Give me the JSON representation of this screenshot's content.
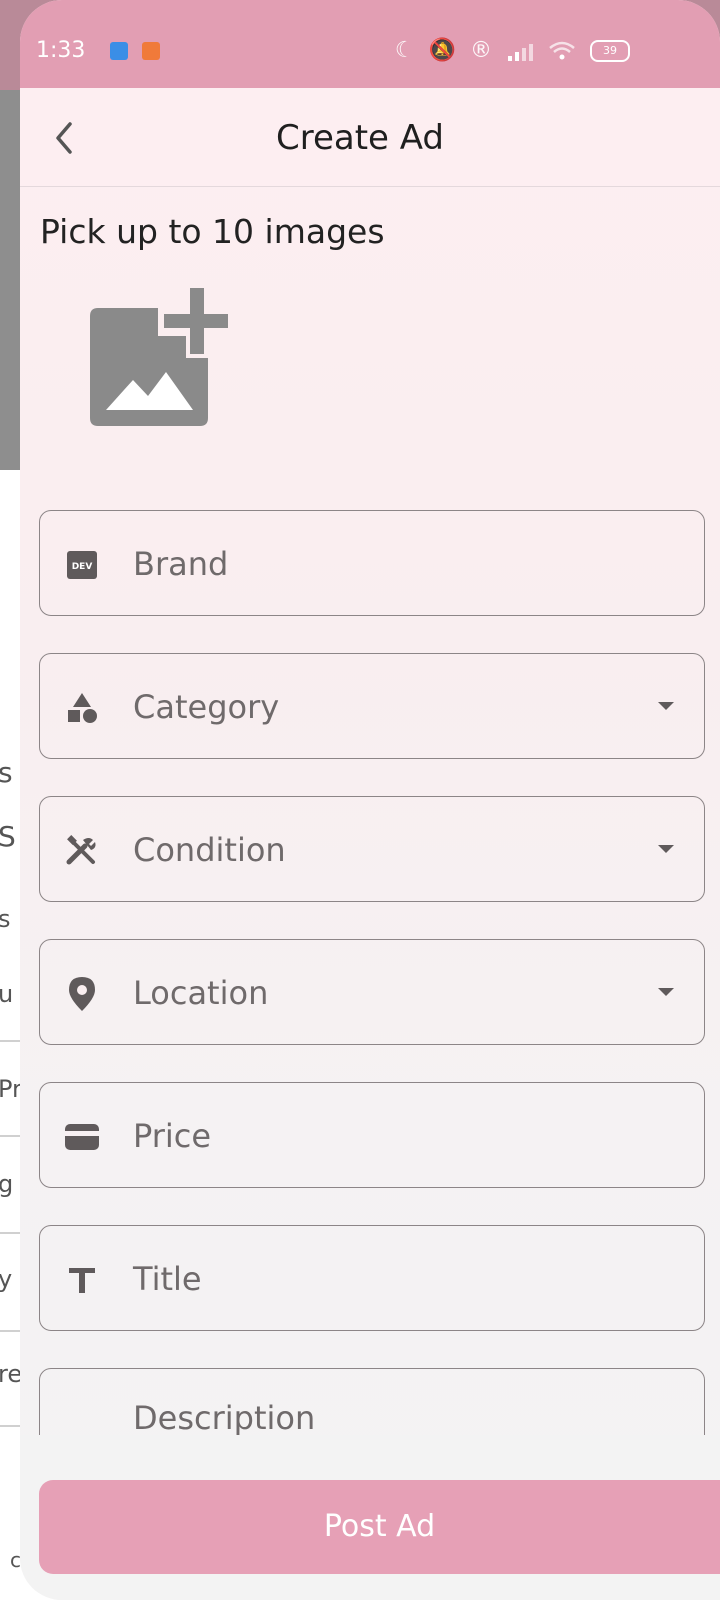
{
  "status_bar": {
    "time": "1:33",
    "battery": "39"
  },
  "app_bar": {
    "title": "Create Ad"
  },
  "images": {
    "label": "Pick up to 10 images"
  },
  "fields": {
    "brand": {
      "label": "Brand",
      "icon": "dev-badge-icon"
    },
    "category": {
      "label": "Category",
      "icon": "category-shapes-icon"
    },
    "condition": {
      "label": "Condition",
      "icon": "tools-icon"
    },
    "location": {
      "label": "Location",
      "icon": "location-pin-icon"
    },
    "price": {
      "label": "Price",
      "icon": "wallet-icon"
    },
    "title": {
      "label": "Title",
      "icon": "text-t-icon"
    },
    "description": {
      "label": "Description"
    }
  },
  "actions": {
    "post_label": "Post Ad"
  },
  "background_page": {
    "fragments": [
      "s",
      "S",
      "s",
      "u",
      "Pr",
      "g",
      "y",
      "re",
      "c"
    ]
  },
  "colors": {
    "accent": "#e29eb3",
    "button": "#e6a0b6",
    "sheet": "#fdeef1"
  }
}
